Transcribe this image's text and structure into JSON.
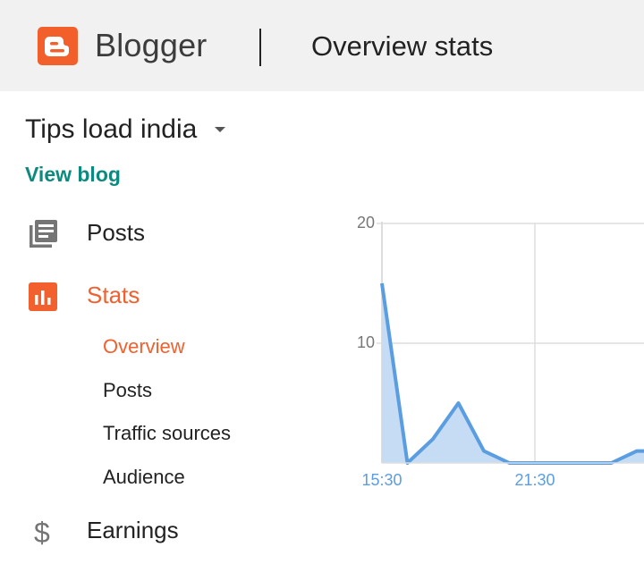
{
  "header": {
    "brand": "Blogger",
    "page_title": "Overview stats",
    "brand_color": "#f25f2b"
  },
  "blog": {
    "name": "Tips load india",
    "view_blog_label": "View blog"
  },
  "nav": {
    "posts_label": "Posts",
    "stats_label": "Stats",
    "earnings_label": "Earnings",
    "stats_sub": {
      "overview": "Overview",
      "posts": "Posts",
      "traffic_sources": "Traffic sources",
      "audience": "Audience"
    },
    "active_color": "#f2602d"
  },
  "chart_data": {
    "type": "area",
    "x": [
      "15:30",
      "",
      "",
      "",
      "",
      "",
      "21:30",
      "",
      "",
      "",
      "",
      ""
    ],
    "values": [
      15,
      0,
      2,
      5,
      1,
      0,
      0,
      0,
      0,
      0,
      1,
      1
    ],
    "ylim": [
      0,
      20
    ],
    "yticks": [
      "20",
      "10"
    ],
    "xticks": [
      "15:30",
      "21:30"
    ],
    "line_color": "#5b9de1",
    "fill_color": "#c5dcf4",
    "grid": true
  }
}
